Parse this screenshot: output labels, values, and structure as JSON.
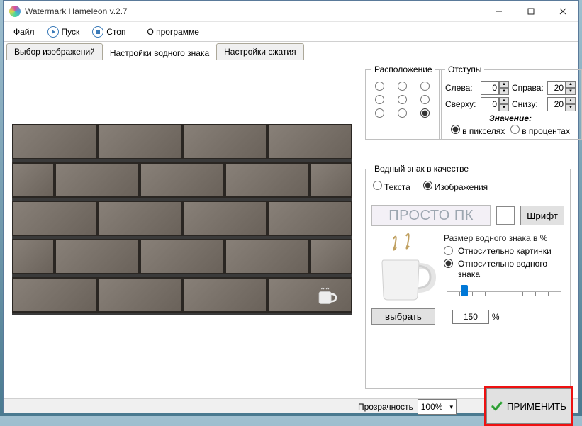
{
  "window_title": "Watermark Hameleon v.2.7",
  "menu": {
    "file": "Файл",
    "start": "Пуск",
    "stop": "Стоп",
    "about": "О программе"
  },
  "tabs": {
    "select": "Выбор изображений",
    "watermark": "Настройки водного знака",
    "compress": "Настройки сжатия"
  },
  "position_legend": "Расположение",
  "margins": {
    "legend": "Отступы",
    "left_lbl": "Слева:",
    "left_val": "0",
    "right_lbl": "Справа:",
    "right_val": "20",
    "top_lbl": "Сверху:",
    "top_val": "0",
    "bottom_lbl": "Снизу:",
    "bottom_val": "20",
    "value_lbl": "Значение:",
    "pixels": "в пикселях",
    "percent": "в процентах"
  },
  "wmtype": {
    "legend": "Водный знак в качестве",
    "text": "Текста",
    "image": "Изображения",
    "sample_text": "ПРОСТО ПК",
    "font_btn": "Шрифт",
    "size_head": "Размер водного знака в %",
    "rel_image": "Относительно картинки",
    "rel_wm": "Относительно водного знака",
    "choose": "выбрать",
    "size_val": "150",
    "pct_sign": "%"
  },
  "opacity": {
    "label": "Прозрачность",
    "value": "100%"
  },
  "apply": "ПРИМЕНИТЬ"
}
